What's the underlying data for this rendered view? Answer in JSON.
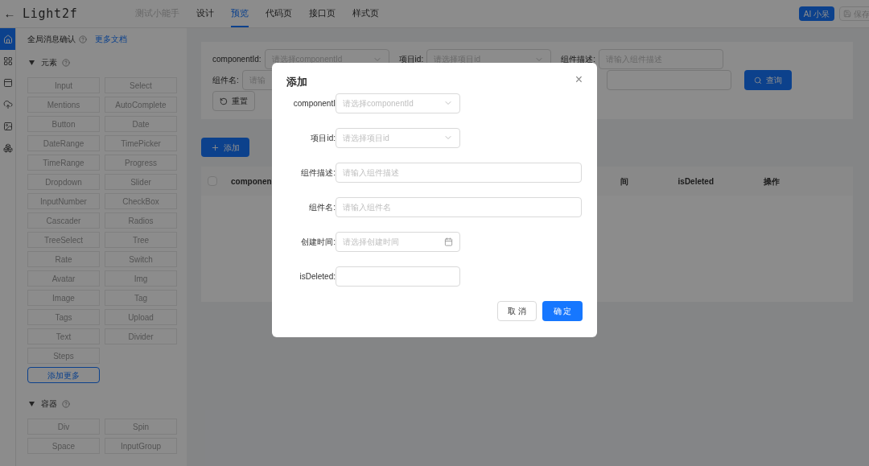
{
  "header": {
    "back": "←",
    "title": "Light2f",
    "tabs": [
      {
        "label": "测试小能手",
        "selected": false,
        "disabled": true
      },
      {
        "label": "设计",
        "selected": false,
        "disabled": false
      },
      {
        "label": "预览",
        "selected": true,
        "disabled": false
      },
      {
        "label": "代码页",
        "selected": false,
        "disabled": false
      },
      {
        "label": "接口页",
        "selected": false,
        "disabled": false
      },
      {
        "label": "样式页",
        "selected": false,
        "disabled": false
      }
    ],
    "ai_button": "AI 小呆",
    "save_button": "保存"
  },
  "rail": [
    {
      "selected": true
    },
    {
      "selected": false
    },
    {
      "selected": false
    },
    {
      "selected": false
    },
    {
      "selected": false
    },
    {
      "selected": false
    }
  ],
  "sidebar": {
    "global_label": "全局消息确认",
    "docs_link": "更多文档",
    "sections": [
      {
        "title": "元素",
        "expanded": true,
        "items": [
          "Input",
          "Select",
          "Mentions",
          "AutoComplete",
          "Button",
          "Date",
          "DateRange",
          "TimePicker",
          "TimeRange",
          "Progress",
          "Dropdown",
          "Slider",
          "InputNumber",
          "CheckBox",
          "Cascader",
          "Radios",
          "TreeSelect",
          "Tree",
          "Rate",
          "Switch",
          "Avatar",
          "Img",
          "Image",
          "Tag",
          "Tags",
          "Upload",
          "Text",
          "Divider",
          "Steps"
        ],
        "more": "添加更多"
      },
      {
        "title": "容器",
        "expanded": true,
        "items": [
          "Div",
          "Spin",
          "Space",
          "InputGroup"
        ]
      }
    ]
  },
  "search": {
    "fields": [
      {
        "label": "componentId:",
        "placeholder": "请选择componentId",
        "kind": "select"
      },
      {
        "label": "项目id:",
        "placeholder": "请选择项目id",
        "kind": "select"
      },
      {
        "label": "组件描述:",
        "placeholder": "请输入组件描述",
        "kind": "input"
      }
    ],
    "row2_label": "组件名:",
    "row2_placeholder": "请输",
    "query": "查询",
    "reset": "重置"
  },
  "add_button": "添加",
  "table": {
    "select_all_checked": false,
    "columns": [
      "componen",
      "间",
      "isDeleted",
      "操作"
    ]
  },
  "modal": {
    "title": "添加",
    "close": "×",
    "fields": [
      {
        "label": "componentI",
        "placeholder": "请选择componentId",
        "kind": "select"
      },
      {
        "label": "项目id:",
        "placeholder": "请选择项目id",
        "kind": "select"
      },
      {
        "label": "组件描述:",
        "placeholder": "请输入组件描述",
        "kind": "input"
      },
      {
        "label": "组件名:",
        "placeholder": "请输入组件名",
        "kind": "input"
      },
      {
        "label": "创建时间:",
        "placeholder": "请选择创建时间",
        "kind": "date"
      },
      {
        "label": "isDeleted:",
        "kind": "short"
      }
    ],
    "cancel": "取 消",
    "ok": "确 定"
  }
}
